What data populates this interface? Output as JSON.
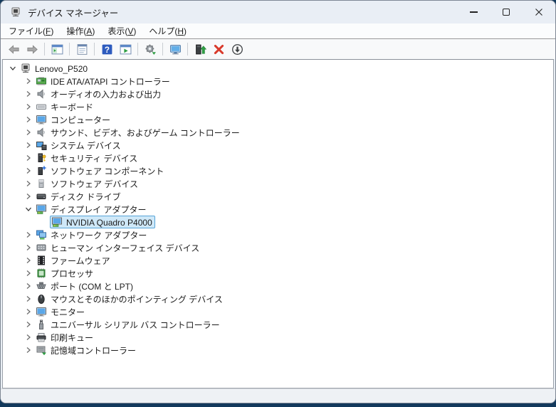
{
  "window": {
    "title": "デバイス マネージャー",
    "app_icon": "device-manager-icon",
    "controls": [
      {
        "name": "minimize-button",
        "icon": "minimize-icon"
      },
      {
        "name": "maximize-button",
        "icon": "maximize-icon"
      },
      {
        "name": "close-button",
        "icon": "close-icon"
      }
    ]
  },
  "menu": {
    "items": [
      {
        "name": "menu-file",
        "label": "ファイル(F)"
      },
      {
        "name": "menu-action",
        "label": "操作(A)"
      },
      {
        "name": "menu-view",
        "label": "表示(V)"
      },
      {
        "name": "menu-help",
        "label": "ヘルプ(H)"
      }
    ]
  },
  "toolbar": {
    "items": [
      {
        "type": "button",
        "name": "back-button",
        "icon": "arrow-left-icon"
      },
      {
        "type": "button",
        "name": "forward-button",
        "icon": "arrow-right-icon"
      },
      {
        "type": "sep"
      },
      {
        "type": "button",
        "name": "show-console-tree-button",
        "icon": "console-tree-icon"
      },
      {
        "type": "sep"
      },
      {
        "type": "button",
        "name": "properties-button",
        "icon": "properties-icon"
      },
      {
        "type": "sep"
      },
      {
        "type": "button",
        "name": "help-button",
        "icon": "help-icon"
      },
      {
        "type": "button",
        "name": "action-pane-button",
        "icon": "action-pane-icon"
      },
      {
        "type": "sep"
      },
      {
        "type": "button",
        "name": "add-hardware-button",
        "icon": "gear-add-icon"
      },
      {
        "type": "sep"
      },
      {
        "type": "button",
        "name": "scan-hardware-changes-button",
        "icon": "scan-computer-icon"
      },
      {
        "type": "sep"
      },
      {
        "type": "button",
        "name": "update-driver-button",
        "icon": "update-driver-icon"
      },
      {
        "type": "button",
        "name": "uninstall-device-button",
        "icon": "uninstall-x-icon"
      },
      {
        "type": "button",
        "name": "disable-device-button",
        "icon": "disable-device-icon"
      }
    ]
  },
  "tree": {
    "items": [
      {
        "label": "Lenovo_P520",
        "depth": 0,
        "expander": "expanded",
        "icon": "computer-root",
        "selected": false
      },
      {
        "label": "IDE ATA/ATAPI コントローラー",
        "depth": 1,
        "expander": "collapsed",
        "icon": "ide-controller",
        "selected": false
      },
      {
        "label": "オーディオの入力および出力",
        "depth": 1,
        "expander": "collapsed",
        "icon": "audio-endpoint",
        "selected": false
      },
      {
        "label": "キーボード",
        "depth": 1,
        "expander": "collapsed",
        "icon": "keyboard",
        "selected": false
      },
      {
        "label": "コンピューター",
        "depth": 1,
        "expander": "collapsed",
        "icon": "computer-monitor",
        "selected": false
      },
      {
        "label": "サウンド、ビデオ、およびゲーム コントローラー",
        "depth": 1,
        "expander": "collapsed",
        "icon": "audio-endpoint",
        "selected": false
      },
      {
        "label": "システム デバイス",
        "depth": 1,
        "expander": "collapsed",
        "icon": "system-device",
        "selected": false
      },
      {
        "label": "セキュリティ デバイス",
        "depth": 1,
        "expander": "collapsed",
        "icon": "security-device",
        "selected": false
      },
      {
        "label": "ソフトウェア コンポーネント",
        "depth": 1,
        "expander": "collapsed",
        "icon": "software-component",
        "selected": false
      },
      {
        "label": "ソフトウェア デバイス",
        "depth": 1,
        "expander": "collapsed",
        "icon": "software-device",
        "selected": false
      },
      {
        "label": "ディスク ドライブ",
        "depth": 1,
        "expander": "collapsed",
        "icon": "disk-drive",
        "selected": false
      },
      {
        "label": "ディスプレイ アダプター",
        "depth": 1,
        "expander": "expanded",
        "icon": "display-adapter",
        "selected": false
      },
      {
        "label": "NVIDIA Quadro P4000",
        "depth": 2,
        "expander": "none",
        "icon": "display-adapter",
        "selected": true
      },
      {
        "label": "ネットワーク アダプター",
        "depth": 1,
        "expander": "collapsed",
        "icon": "network-adapter",
        "selected": false
      },
      {
        "label": "ヒューマン インターフェイス デバイス",
        "depth": 1,
        "expander": "collapsed",
        "icon": "hid-device",
        "selected": false
      },
      {
        "label": "ファームウェア",
        "depth": 1,
        "expander": "collapsed",
        "icon": "firmware",
        "selected": false
      },
      {
        "label": "プロセッサ",
        "depth": 1,
        "expander": "collapsed",
        "icon": "processor",
        "selected": false
      },
      {
        "label": "ポート (COM と LPT)",
        "depth": 1,
        "expander": "collapsed",
        "icon": "port",
        "selected": false
      },
      {
        "label": "マウスとそのほかのポインティング デバイス",
        "depth": 1,
        "expander": "collapsed",
        "icon": "mouse",
        "selected": false
      },
      {
        "label": "モニター",
        "depth": 1,
        "expander": "collapsed",
        "icon": "computer-monitor",
        "selected": false
      },
      {
        "label": "ユニバーサル シリアル バス コントローラー",
        "depth": 1,
        "expander": "collapsed",
        "icon": "usb-controller",
        "selected": false
      },
      {
        "label": "印刷キュー",
        "depth": 1,
        "expander": "collapsed",
        "icon": "print-queue",
        "selected": false
      },
      {
        "label": "記憶域コントローラー",
        "depth": 1,
        "expander": "collapsed",
        "icon": "storage-controller",
        "selected": false
      }
    ]
  },
  "statusbar": {
    "text": ""
  },
  "colors": {
    "titlebar_bg": "#e9eef5",
    "selection_bg": "#cfe8f8",
    "selection_border": "#56a4d8",
    "desktop_bg": "#12395c",
    "help_icon_blue": "#2d5bbe",
    "uninstall_red": "#d93a2b"
  }
}
